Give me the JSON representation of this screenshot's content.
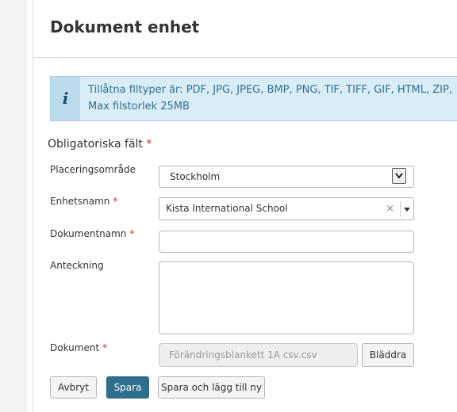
{
  "page": {
    "title": "Dokument enhet"
  },
  "info": {
    "icon": "info-icon",
    "icon_glyph": "i",
    "line1": "Tillåtna filtyper är: PDF, JPG, JPEG, BMP, PNG, TIF, TIFF, GIF, HTML, ZIP,",
    "line2": "Max filstorlek 25MB"
  },
  "form": {
    "required_text": "Obligatoriska fält",
    "required_marker": "*",
    "placement": {
      "label": "Placeringsområde",
      "value": "Stockholm"
    },
    "unit": {
      "label": "Enhetsnamn",
      "value": "Kista International School",
      "clear": "×"
    },
    "docname": {
      "label": "Dokumentnamn",
      "value": ""
    },
    "note": {
      "label": "Anteckning",
      "value": ""
    },
    "document": {
      "label": "Dokument",
      "value": "Förändringsblankett 1A csv.csv"
    }
  },
  "buttons": {
    "browse": "Bläddra",
    "cancel": "Avbryt",
    "save": "Spara",
    "save_add": "Spara och lägg till ny"
  },
  "colors": {
    "primary": "#2f6f8e",
    "info_bg": "#d9edf7",
    "required": "#c9302c"
  }
}
